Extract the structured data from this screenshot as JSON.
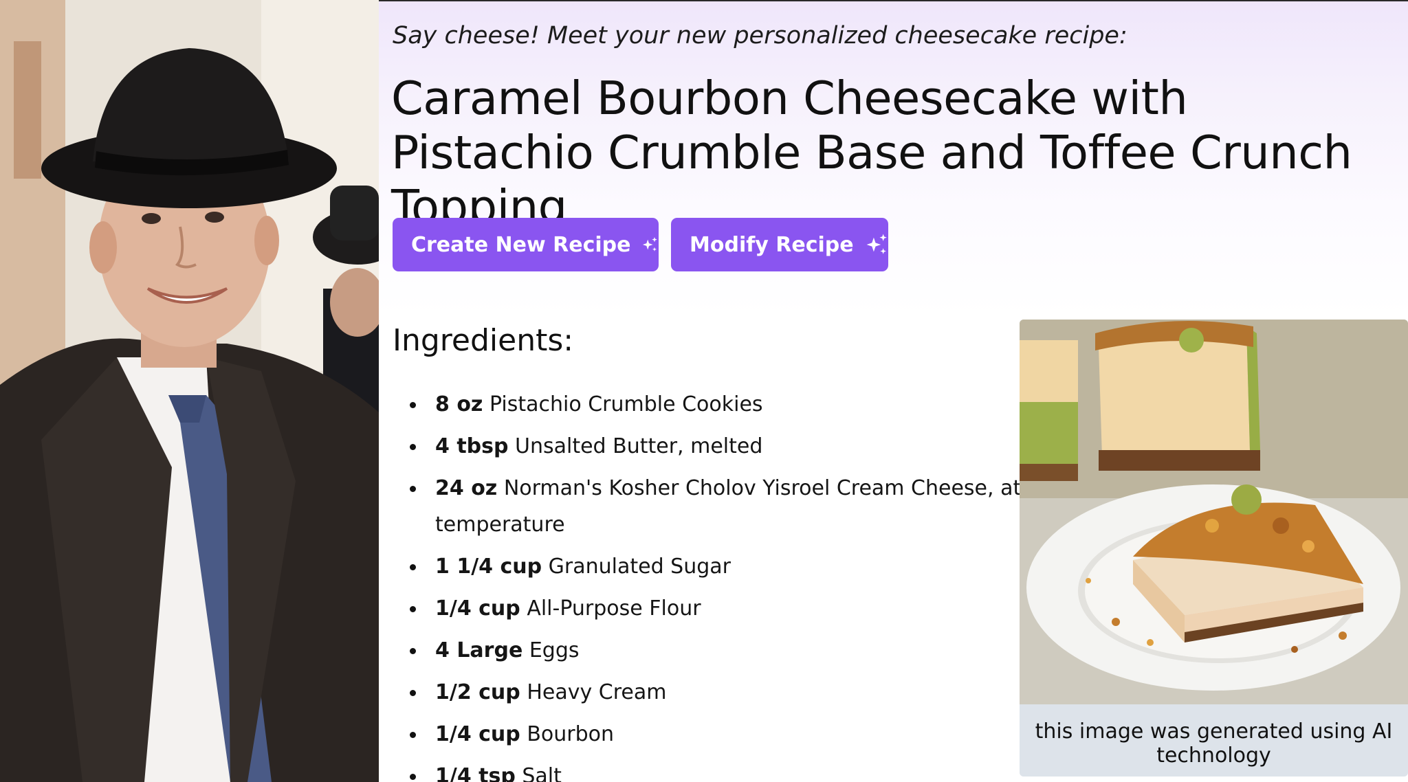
{
  "recipe": {
    "tagline": "Say cheese! Meet your new personalized cheesecake recipe:",
    "title": "Caramel Bourbon Cheesecake with Pistachio Crumble Base and Toffee Crunch Topping",
    "buttons": {
      "create_label": "Create New Recipe",
      "modify_label": "Modify Recipe",
      "accent_color": "#8a55f0"
    },
    "ingredients_heading": "Ingredients:",
    "ingredients": [
      {
        "qty": "8 oz",
        "item": "Pistachio Crumble Cookies"
      },
      {
        "qty": "4 tbsp",
        "item": "Unsalted Butter, melted"
      },
      {
        "qty": "24 oz",
        "item": "Norman's Kosher Cholov Yisroel Cream Cheese, at room temperature"
      },
      {
        "qty": "1 1/4 cup",
        "item": "Granulated Sugar"
      },
      {
        "qty": "1/4 cup",
        "item": "All-Purpose Flour"
      },
      {
        "qty": "4 Large",
        "item": "Eggs"
      },
      {
        "qty": "1/2 cup",
        "item": "Heavy Cream"
      },
      {
        "qty": "1/4 cup",
        "item": "Bourbon"
      },
      {
        "qty": "1/4 tsp",
        "item": "Salt"
      }
    ],
    "image_caption": "this image was generated using AI technology"
  },
  "icons": {
    "button_icon": "sparkle-icon"
  }
}
